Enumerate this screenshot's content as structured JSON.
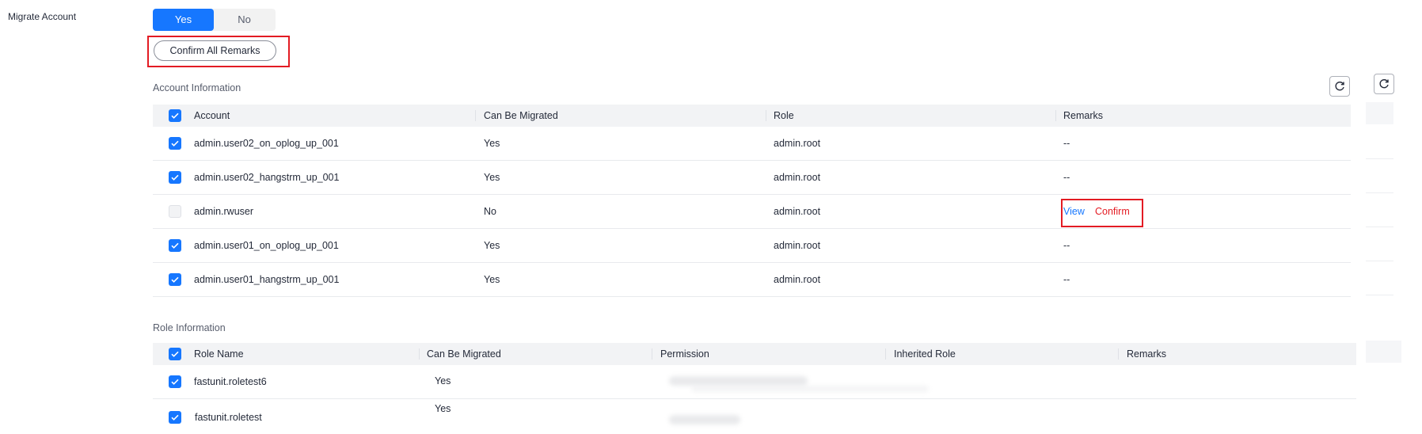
{
  "migrate": {
    "label": "Migrate Account",
    "options": [
      "Yes",
      "No"
    ],
    "selected": "Yes",
    "confirm_all_label": "Confirm All Remarks",
    "accent_color": "#1677ff",
    "highlight_color": "#e31b23"
  },
  "account_info": {
    "title": "Account Information",
    "columns": [
      "Account",
      "Can Be Migrated",
      "Role",
      "Remarks"
    ],
    "rows": [
      {
        "account": "admin.user02_on_oplog_up_001",
        "can_migrate": "Yes",
        "role": "admin.root",
        "remarks": "--",
        "checked": true
      },
      {
        "account": "admin.user02_hangstrm_up_001",
        "can_migrate": "Yes",
        "role": "admin.root",
        "remarks": "--",
        "checked": true
      },
      {
        "account": "admin.rwuser",
        "can_migrate": "No",
        "role": "admin.root",
        "remarks": "",
        "view_label": "View",
        "confirm_label": "Confirm",
        "checked": false
      },
      {
        "account": "admin.user01_on_oplog_up_001",
        "can_migrate": "Yes",
        "role": "admin.root",
        "remarks": "--",
        "checked": true
      },
      {
        "account": "admin.user01_hangstrm_up_001",
        "can_migrate": "Yes",
        "role": "admin.root",
        "remarks": "--",
        "checked": true
      }
    ]
  },
  "role_info": {
    "title": "Role Information",
    "columns": [
      "Role Name",
      "Can Be Migrated",
      "Permission",
      "Inherited Role",
      "Remarks"
    ],
    "rows": [
      {
        "role_name": "fastunit.roletest6",
        "can_migrate": "Yes",
        "checked": true
      },
      {
        "role_name": "fastunit.roletest",
        "can_migrate": "Yes",
        "checked": true
      }
    ]
  },
  "icons": {
    "refresh": "refresh-icon",
    "checkbox": "checkbox-icon"
  }
}
